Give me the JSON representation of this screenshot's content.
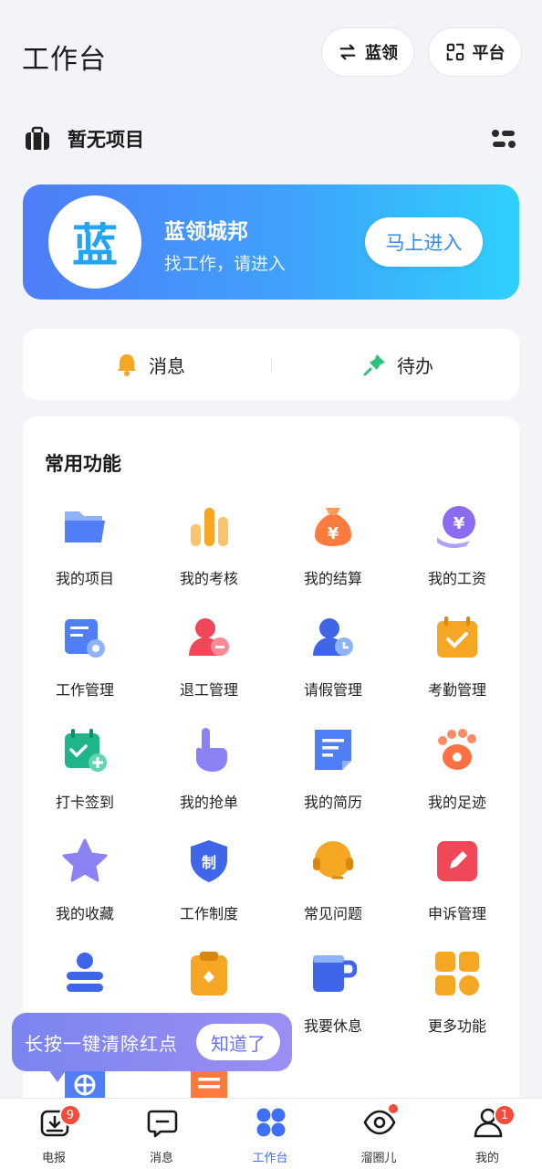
{
  "header": {
    "title": "工作台",
    "switch_label": "蓝领",
    "platform_label": "平台"
  },
  "project": {
    "title": "暂无项目"
  },
  "banner": {
    "logo_char": "蓝",
    "name": "蓝领城邦",
    "subtitle": "找工作，请进入",
    "button": "马上进入"
  },
  "quick": {
    "messages": "消息",
    "todo": "待办"
  },
  "functions": {
    "title": "常用功能",
    "items": [
      {
        "label": "我的项目",
        "icon": "folder-icon"
      },
      {
        "label": "我的考核",
        "icon": "bar-chart-icon"
      },
      {
        "label": "我的结算",
        "icon": "money-bag-icon"
      },
      {
        "label": "我的工资",
        "icon": "salary-icon"
      },
      {
        "label": "工作管理",
        "icon": "work-manage-icon"
      },
      {
        "label": "退工管理",
        "icon": "resign-icon"
      },
      {
        "label": "请假管理",
        "icon": "leave-icon"
      },
      {
        "label": "考勤管理",
        "icon": "attendance-icon"
      },
      {
        "label": "打卡签到",
        "icon": "checkin-icon"
      },
      {
        "label": "我的抢单",
        "icon": "grab-order-icon"
      },
      {
        "label": "我的简历",
        "icon": "resume-icon"
      },
      {
        "label": "我的足迹",
        "icon": "footprint-icon"
      },
      {
        "label": "我的收藏",
        "icon": "star-icon"
      },
      {
        "label": "工作制度",
        "icon": "policy-shield-icon"
      },
      {
        "label": "常见问题",
        "icon": "faq-headset-icon"
      },
      {
        "label": "申诉管理",
        "icon": "appeal-icon"
      },
      {
        "label": "",
        "icon": "profile-stack-icon"
      },
      {
        "label": "",
        "icon": "clipboard-icon"
      },
      {
        "label": "我要休息",
        "icon": "rest-cup-icon"
      },
      {
        "label": "更多功能",
        "icon": "more-grid-icon"
      }
    ]
  },
  "tooltip": {
    "text": "长按一键清除红点",
    "button": "知道了"
  },
  "tabbar": [
    {
      "label": "电报",
      "badge": "9"
    },
    {
      "label": "消息",
      "badge": ""
    },
    {
      "label": "工作台",
      "badge": ""
    },
    {
      "label": "溜圈儿",
      "badge": ""
    },
    {
      "label": "我的",
      "badge": "1"
    }
  ],
  "colors": {
    "accent": "#3f6ff3",
    "badge": "#f44b3b",
    "banner_start": "#4e7df9",
    "banner_end": "#2fd0fc"
  }
}
